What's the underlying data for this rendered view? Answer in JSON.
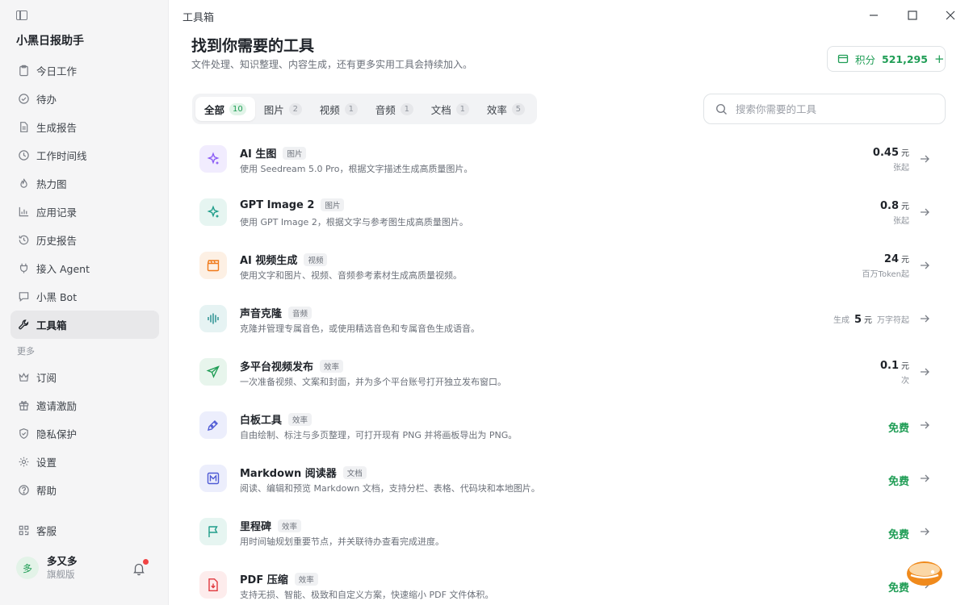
{
  "app": {
    "name": "小黑日报助手",
    "window_title": "工具箱"
  },
  "sidebar": {
    "items": [
      {
        "label": "今日工作",
        "icon": "clipboard-icon"
      },
      {
        "label": "待办",
        "icon": "check-circle-icon"
      },
      {
        "label": "生成报告",
        "icon": "document-icon"
      },
      {
        "label": "工作时间线",
        "icon": "clock-icon"
      },
      {
        "label": "热力图",
        "icon": "flame-icon"
      },
      {
        "label": "应用记录",
        "icon": "bar-chart-icon"
      },
      {
        "label": "历史报告",
        "icon": "history-icon"
      },
      {
        "label": "接入 Agent",
        "icon": "plug-icon"
      },
      {
        "label": "小黑 Bot",
        "icon": "chat-icon"
      },
      {
        "label": "工具箱",
        "icon": "wrench-icon",
        "active": true
      }
    ],
    "more_label": "更多",
    "more_items": [
      {
        "label": "订阅",
        "icon": "crown-icon"
      },
      {
        "label": "邀请激励",
        "icon": "gift-icon"
      },
      {
        "label": "隐私保护",
        "icon": "shield-icon"
      },
      {
        "label": "设置",
        "icon": "gear-icon"
      },
      {
        "label": "帮助",
        "icon": "help-icon"
      }
    ],
    "service_label": "客服",
    "user": {
      "avatar": "多",
      "name": "多又多",
      "plan": "旗舰版"
    }
  },
  "header": {
    "title": "找到你需要的工具",
    "subtitle": "文件处理、知识整理、内容生成，还有更多实用工具会持续加入。",
    "points_label": "积分",
    "points_value": "521,295",
    "points_add": "+"
  },
  "tabs": [
    {
      "label": "全部",
      "count": "10",
      "active": true
    },
    {
      "label": "图片",
      "count": "2"
    },
    {
      "label": "视频",
      "count": "1"
    },
    {
      "label": "音频",
      "count": "1"
    },
    {
      "label": "文档",
      "count": "1"
    },
    {
      "label": "效率",
      "count": "5"
    }
  ],
  "search": {
    "placeholder": "搜索你需要的工具"
  },
  "tools": [
    {
      "name": "AI 生图",
      "tag": "图片",
      "desc": "使用 Seedream 5.0 Pro，根据文字描述生成高质量图片。",
      "price": "0.45",
      "unit": "元",
      "sub": "张起",
      "icon": "sparkle-icon",
      "color": "#8b5cf6",
      "bg": "#f1ecfe"
    },
    {
      "name": "GPT Image 2",
      "tag": "图片",
      "desc": "使用 GPT Image 2，根据文字与参考图生成高质量图片。",
      "price": "0.8",
      "unit": "元",
      "sub": "张起",
      "icon": "sparkle-icon",
      "color": "#1f9d8a",
      "bg": "#e6f5f1"
    },
    {
      "name": "AI 视频生成",
      "tag": "视频",
      "desc": "使用文字和图片、视频、音频参考素材生成高质量视频。",
      "price": "24",
      "unit": "元",
      "sub": "百万Token起",
      "icon": "clapper-icon",
      "color": "#f07a1a",
      "bg": "#fdf0e4"
    },
    {
      "name": "声音克隆",
      "tag": "音频",
      "desc": "克隆并管理专属音色，或使用精选音色和专属音色生成语音。",
      "pre": "生成",
      "price": "5",
      "unit": "元",
      "post": "万字符起",
      "icon": "waveform-icon",
      "color": "#1f8a8a",
      "bg": "#e6f3f3"
    },
    {
      "name": "多平台视频发布",
      "tag": "效率",
      "desc": "一次准备视频、文案和封面，并为多个平台账号打开独立发布窗口。",
      "price": "0.1",
      "unit": "元",
      "sub": "次",
      "icon": "send-icon",
      "color": "#1f9d55",
      "bg": "#e7f5ec"
    },
    {
      "name": "白板工具",
      "tag": "效率",
      "desc": "自由绘制、标注与多页整理，可打开现有 PNG 并将画板导出为 PNG。",
      "free": "免费",
      "icon": "pen-icon",
      "color": "#4f5bd5",
      "bg": "#eceefc"
    },
    {
      "name": "Markdown 阅读器",
      "tag": "文档",
      "desc": "阅读、编辑和预览 Markdown 文档，支持分栏、表格、代码块和本地图片。",
      "free": "免费",
      "icon": "markdown-icon",
      "color": "#4f5bd5",
      "bg": "#eceefc"
    },
    {
      "name": "里程碑",
      "tag": "效率",
      "desc": "用时间轴规划重要节点，并关联待办查看完成进度。",
      "free": "免费",
      "icon": "flag-icon",
      "color": "#1f9d8a",
      "bg": "#e6f5f1"
    },
    {
      "name": "PDF 压缩",
      "tag": "效率",
      "desc": "支持无损、智能、极致和自定义方案，快速缩小 PDF 文件体积。",
      "free": "免费",
      "icon": "file-download-icon",
      "color": "#e0393e",
      "bg": "#fdecec"
    }
  ]
}
